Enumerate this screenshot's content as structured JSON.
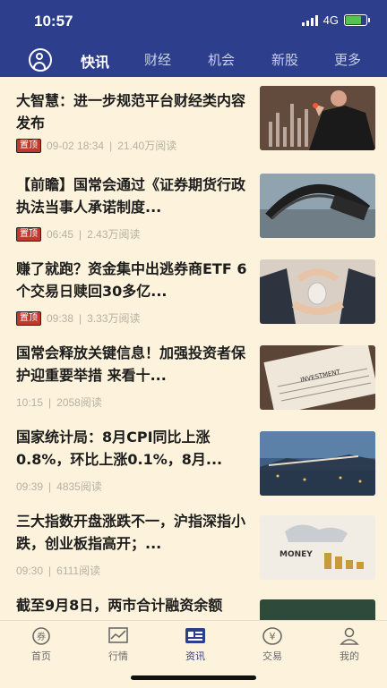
{
  "status": {
    "time": "10:57",
    "network": "4G"
  },
  "nav": {
    "tabs": [
      {
        "label": "快讯",
        "active": true
      },
      {
        "label": "财经",
        "active": false
      },
      {
        "label": "机会",
        "active": false
      },
      {
        "label": "新股",
        "active": false
      },
      {
        "label": "更多",
        "active": false
      }
    ]
  },
  "news": [
    {
      "title": "大智慧：进一步规范平台财经类内容发布",
      "badge": "置顶",
      "time": "09-02 18:34",
      "reads": "21.40万阅读"
    },
    {
      "title": "【前瞻】国常会通过《证券期货行政执法当事人承诺制度...",
      "badge": "置顶",
      "time": "06:45",
      "reads": "2.43万阅读"
    },
    {
      "title": "赚了就跑？资金集中出逃券商ETF 6个交易日赎回30多亿...",
      "badge": "置顶",
      "time": "09:38",
      "reads": "3.33万阅读"
    },
    {
      "title": "国常会释放关键信息！加强投资者保护迎重要举措 来看十...",
      "badge": "",
      "time": "10:15",
      "reads": "2058阅读"
    },
    {
      "title": "国家统计局：8月CPI同比上涨0.8%，环比上涨0.1%，8月...",
      "badge": "",
      "time": "09:39",
      "reads": "4835阅读"
    },
    {
      "title": "三大指数开盘涨跌不一，沪指深指小跌，创业板指高开；...",
      "badge": "",
      "time": "09:30",
      "reads": "6111阅读"
    },
    {
      "title": "截至9月8日，两市合计融资余额",
      "badge": "",
      "time": "",
      "reads": ""
    }
  ],
  "thumb6_text": "MONEY",
  "thumb4_text": "INVESTMENT",
  "tabbar": [
    {
      "label": "首页",
      "icon": "home-coin-icon"
    },
    {
      "label": "行情",
      "icon": "chart-icon"
    },
    {
      "label": "资讯",
      "icon": "news-icon"
    },
    {
      "label": "交易",
      "icon": "yen-icon"
    },
    {
      "label": "我的",
      "icon": "profile-icon"
    }
  ]
}
